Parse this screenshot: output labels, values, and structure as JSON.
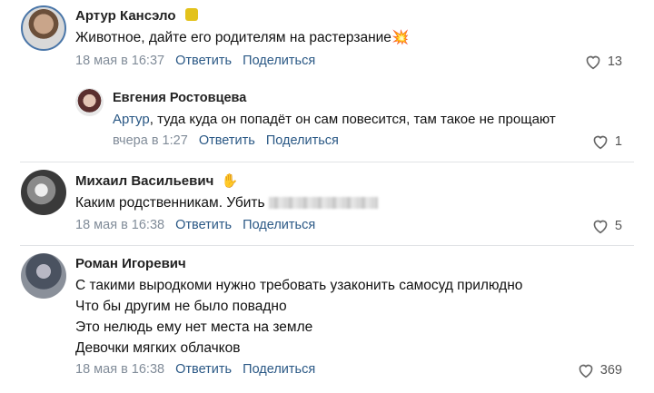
{
  "comments": [
    {
      "author": "Артур Кансэло",
      "text": "Животное, дайте его родителям на растерзание",
      "date": "18 мая в 16:37",
      "reply_label": "Ответить",
      "share_label": "Поделиться",
      "likes": "13",
      "reply": {
        "author": "Евгения Ростовцева",
        "mention": "Артур",
        "text": ", туда куда он попадёт он сам повесится, там такое не прощают",
        "date": "вчера в 1:27",
        "reply_label": "Ответить",
        "share_label": "Поделиться",
        "likes": "1"
      }
    },
    {
      "author": "Михаил Васильевич",
      "text": "Каким родственникам. Убить",
      "date": "18 мая в 16:38",
      "reply_label": "Ответить",
      "share_label": "Поделиться",
      "likes": "5"
    },
    {
      "author": "Роман Игоревич",
      "lines": [
        "С такими выродкоми нужно требовать узаконить самосуд прилюдно",
        "Что бы другим не было повадно",
        "Это нелюдь ему нет места на земле",
        "Девочки мягких облачков"
      ],
      "date": "18 мая в 16:38",
      "reply_label": "Ответить",
      "share_label": "Поделиться",
      "likes": "369"
    }
  ],
  "colors": {
    "link": "#2a5885",
    "meta": "#818c99",
    "divider": "#e1e3e6"
  }
}
